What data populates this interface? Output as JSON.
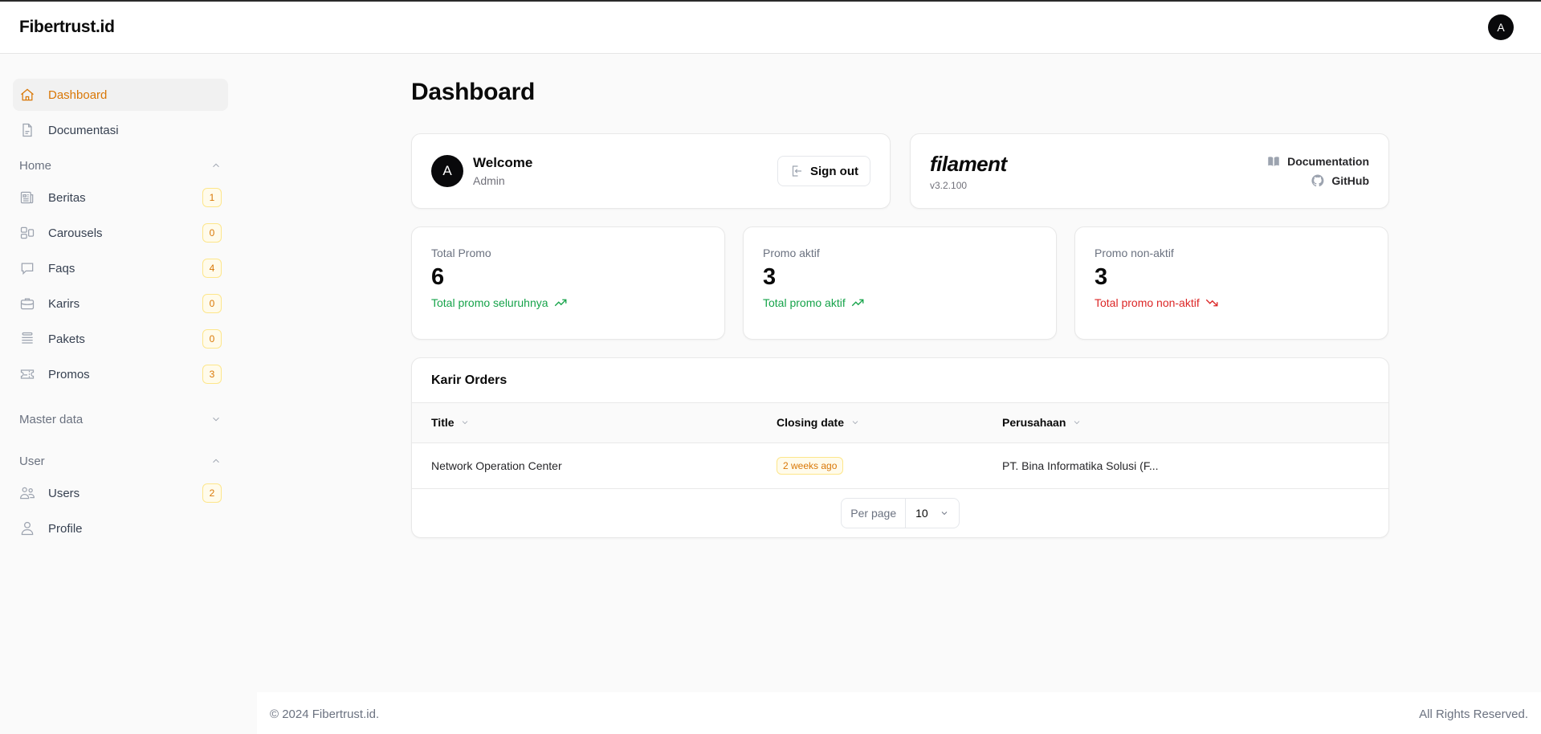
{
  "topbar": {
    "brand": "Fibertrust.id",
    "user_initial": "A"
  },
  "sidebar": {
    "items": [
      {
        "label": "Dashboard",
        "icon": "home-icon",
        "active": true
      },
      {
        "label": "Documentasi",
        "icon": "document-icon"
      }
    ],
    "groups": [
      {
        "label": "Home",
        "expanded": true,
        "items": [
          {
            "label": "Beritas",
            "icon": "newspaper-icon",
            "badge": "1"
          },
          {
            "label": "Carousels",
            "icon": "layout-icon",
            "badge": "0"
          },
          {
            "label": "Faqs",
            "icon": "chat-bubble-icon",
            "badge": "4"
          },
          {
            "label": "Karirs",
            "icon": "briefcase-icon",
            "badge": "0"
          },
          {
            "label": "Pakets",
            "icon": "stack-icon",
            "badge": "0"
          },
          {
            "label": "Promos",
            "icon": "ticket-icon",
            "badge": "3"
          }
        ]
      },
      {
        "label": "Master data",
        "expanded": false,
        "items": []
      },
      {
        "label": "User",
        "expanded": true,
        "items": [
          {
            "label": "Users",
            "icon": "users-icon",
            "badge": "2"
          },
          {
            "label": "Profile",
            "icon": "user-icon"
          }
        ]
      }
    ]
  },
  "main": {
    "title": "Dashboard",
    "welcome": {
      "initial": "A",
      "heading": "Welcome",
      "name": "Admin",
      "signout_label": "Sign out"
    },
    "filament": {
      "logo": "filament",
      "version": "v3.2.100",
      "doc_label": "Documentation",
      "github_label": "GitHub"
    },
    "stats": [
      {
        "label": "Total Promo",
        "value": "6",
        "description": "Total promo seluruhnya",
        "trend": "up",
        "color": "#16a34a"
      },
      {
        "label": "Promo aktif",
        "value": "3",
        "description": "Total promo aktif",
        "trend": "up",
        "color": "#16a34a"
      },
      {
        "label": "Promo non-aktif",
        "value": "3",
        "description": "Total promo non-aktif",
        "trend": "down",
        "color": "#dc2626"
      }
    ],
    "table": {
      "heading": "Karir Orders",
      "columns": [
        "Title",
        "Closing date",
        "Perusahaan"
      ],
      "rows": [
        {
          "title": "Network Operation Center",
          "closing_date": "2 weeks ago",
          "perusahaan": "PT. Bina Informatika Solusi (F..."
        }
      ],
      "per_page_label": "Per page",
      "per_page_value": "10"
    }
  },
  "footer": {
    "copyright": "© 2024 Fibertrust.id.",
    "rights": "All Rights Reserved."
  },
  "colors": {
    "accent": "#d97706",
    "success": "#16a34a",
    "danger": "#dc2626"
  }
}
